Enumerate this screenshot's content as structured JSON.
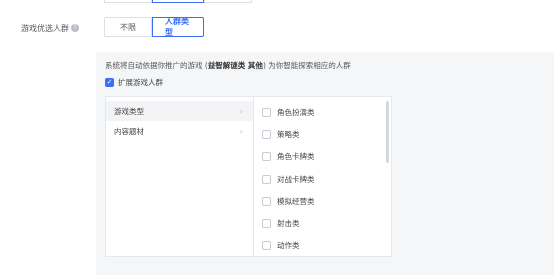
{
  "filter": {
    "label": "游戏优选人群",
    "help_icon": "question-circle-icon",
    "options": [
      "不限",
      "人群类型"
    ],
    "selected": "人群类型"
  },
  "panel": {
    "desc_prefix": "系统将自动依据你推广的游戏 (",
    "desc_bold": "益智解谜类 其他",
    "desc_suffix": ") 为你智能探索相应的人群",
    "expand_label": "扩展游戏人群",
    "expand_checked": true
  },
  "cascader": {
    "categories": [
      {
        "label": "游戏类型",
        "active": true
      },
      {
        "label": "内容题材",
        "active": false
      }
    ],
    "options": [
      "角色扮演类",
      "策略类",
      "角色卡牌类",
      "对战卡牌类",
      "模拟经营类",
      "射击类",
      "动作类"
    ]
  },
  "colors": {
    "accent": "#3a6ff7",
    "panel_bg": "#f5f6f8"
  }
}
